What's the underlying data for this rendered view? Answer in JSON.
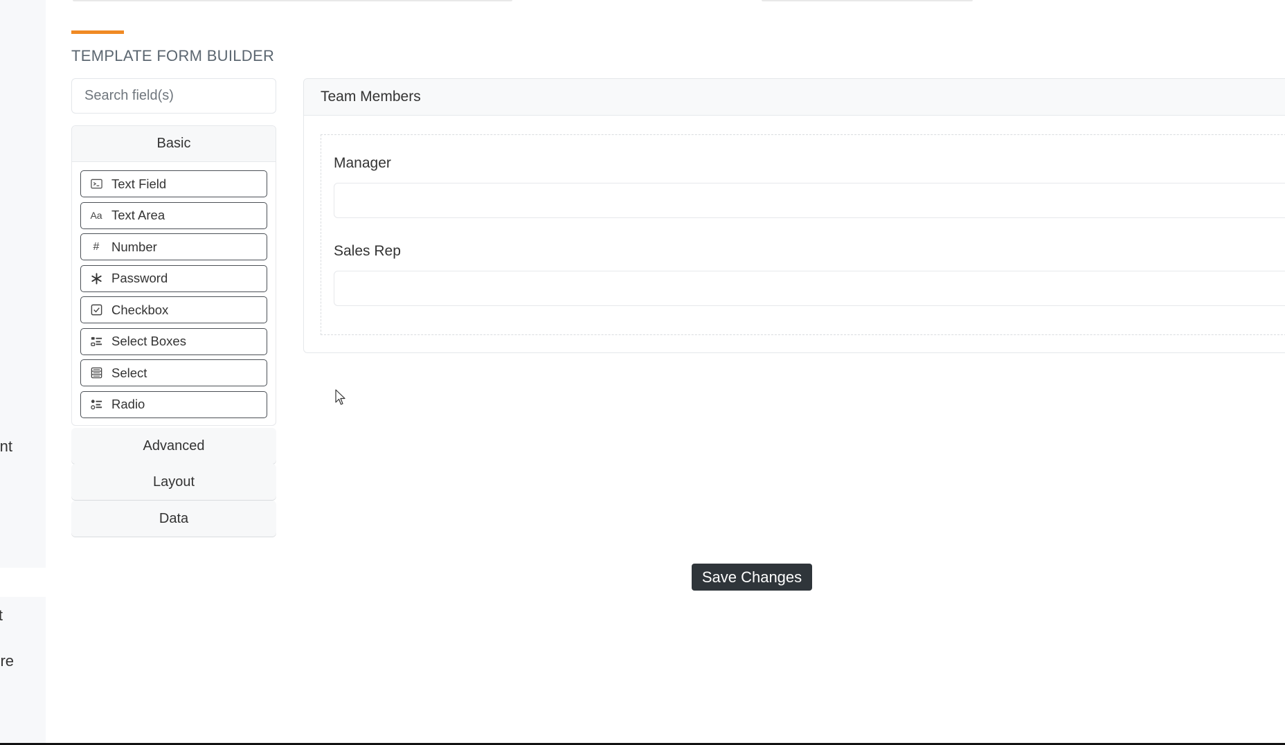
{
  "left_fragments": {
    "text_1": "nt",
    "text_2": "t",
    "text_3": "re!"
  },
  "builder": {
    "title": "TEMPLATE FORM BUILDER",
    "search_placeholder": "Search field(s)",
    "groups": {
      "basic": {
        "label": "Basic",
        "items": [
          {
            "label": "Text Field",
            "icon": "terminal-icon"
          },
          {
            "label": "Text Area",
            "icon": "font-icon"
          },
          {
            "label": "Number",
            "icon": "hash-icon"
          },
          {
            "label": "Password",
            "icon": "asterisk-icon"
          },
          {
            "label": "Checkbox",
            "icon": "check-square-icon"
          },
          {
            "label": "Select Boxes",
            "icon": "list-check-icon"
          },
          {
            "label": "Select",
            "icon": "th-list-icon"
          },
          {
            "label": "Radio",
            "icon": "list-ul-icon"
          }
        ]
      },
      "advanced": {
        "label": "Advanced"
      },
      "layout": {
        "label": "Layout"
      },
      "data": {
        "label": "Data"
      }
    }
  },
  "form_panel": {
    "title": "Team Members",
    "fields": [
      {
        "label": "Manager",
        "value": ""
      },
      {
        "label": "Sales Rep",
        "value": ""
      }
    ]
  },
  "actions": {
    "save_label": "Save Changes"
  },
  "colors": {
    "accent": "#f08a24",
    "save_button_bg": "#2f353a"
  }
}
